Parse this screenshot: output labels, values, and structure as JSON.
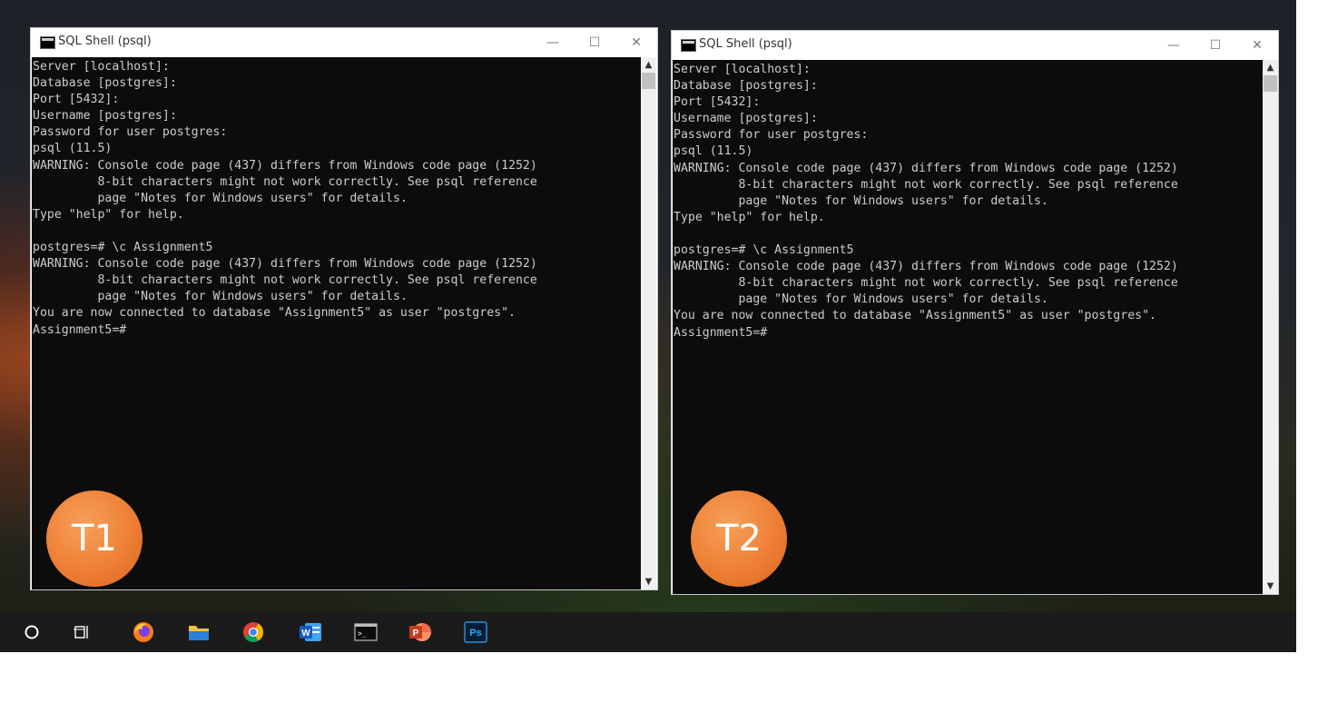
{
  "windows": [
    {
      "title": "SQL Shell (psql)",
      "controls": {
        "minimize": "—",
        "maximize": "☐",
        "close": "✕"
      },
      "lines": [
        "Server [localhost]:",
        "Database [postgres]:",
        "Port [5432]:",
        "Username [postgres]:",
        "Password for user postgres:",
        "psql (11.5)",
        "WARNING: Console code page (437) differs from Windows code page (1252)",
        "         8-bit characters might not work correctly. See psql reference",
        "         page \"Notes for Windows users\" for details.",
        "Type \"help\" for help.",
        "",
        "postgres=# \\c Assignment5",
        "WARNING: Console code page (437) differs from Windows code page (1252)",
        "         8-bit characters might not work correctly. See psql reference",
        "         page \"Notes for Windows users\" for details.",
        "You are now connected to database \"Assignment5\" as user \"postgres\".",
        "Assignment5=#"
      ],
      "badge": "T1"
    },
    {
      "title": "SQL Shell (psql)",
      "controls": {
        "minimize": "—",
        "maximize": "☐",
        "close": "✕"
      },
      "lines": [
        "Server [localhost]:",
        "Database [postgres]:",
        "Port [5432]:",
        "Username [postgres]:",
        "Password for user postgres:",
        "psql (11.5)",
        "WARNING: Console code page (437) differs from Windows code page (1252)",
        "         8-bit characters might not work correctly. See psql reference",
        "         page \"Notes for Windows users\" for details.",
        "Type \"help\" for help.",
        "",
        "postgres=# \\c Assignment5",
        "WARNING: Console code page (437) differs from Windows code page (1252)",
        "         8-bit characters might not work correctly. See psql reference",
        "         page \"Notes for Windows users\" for details.",
        "You are now connected to database \"Assignment5\" as user \"postgres\".",
        "Assignment5=#"
      ],
      "badge": "T2"
    }
  ],
  "taskbar": {
    "icons": [
      "cortana-icon",
      "task-view-icon",
      "firefox-icon",
      "file-explorer-icon",
      "chrome-icon",
      "word-icon",
      "terminal-icon",
      "powerpoint-icon",
      "photoshop-icon"
    ],
    "word_letter": "W",
    "powerpoint_letter": "P",
    "photoshop_label": "Ps",
    "terminal_glyph": ">_"
  }
}
